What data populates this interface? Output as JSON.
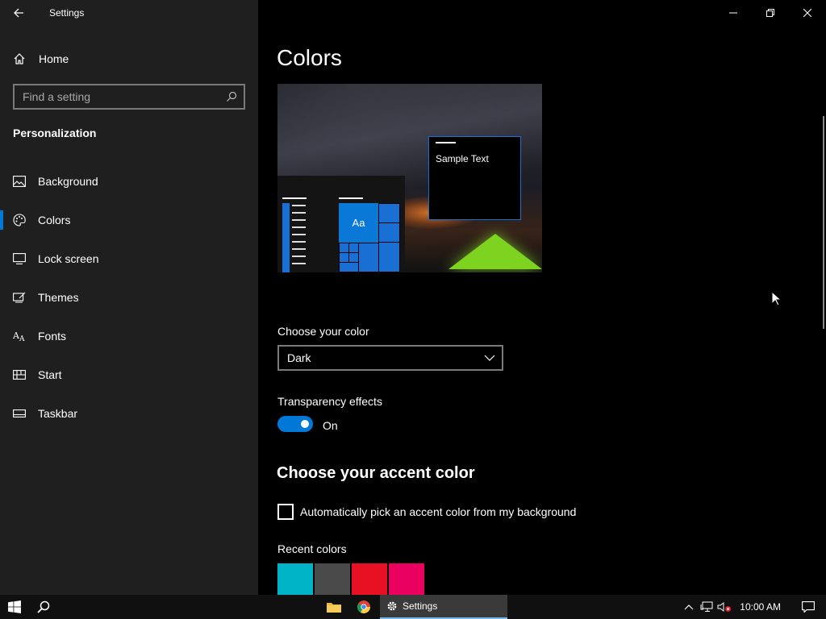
{
  "window": {
    "title": "Settings",
    "controls": {
      "minimize": "minimize",
      "maximize": "restore",
      "close": "close"
    }
  },
  "sidebar": {
    "home_label": "Home",
    "search": {
      "placeholder": "Find a setting"
    },
    "section_title": "Personalization",
    "items": [
      {
        "label": "Background",
        "icon": "picture-icon",
        "active": false
      },
      {
        "label": "Colors",
        "icon": "palette-icon",
        "active": true
      },
      {
        "label": "Lock screen",
        "icon": "lock-screen-icon",
        "active": false
      },
      {
        "label": "Themes",
        "icon": "themes-icon",
        "active": false
      },
      {
        "label": "Fonts",
        "icon": "fonts-icon",
        "active": false
      },
      {
        "label": "Start",
        "icon": "start-icon",
        "active": false
      },
      {
        "label": "Taskbar",
        "icon": "taskbar-icon",
        "active": false
      }
    ]
  },
  "main": {
    "title": "Colors",
    "preview": {
      "sample_text": "Sample Text",
      "tile_text": "Aa"
    },
    "choose_color": {
      "label": "Choose your color",
      "selected": "Dark"
    },
    "transparency": {
      "label": "Transparency effects",
      "state": "On",
      "enabled": true
    },
    "accent_heading": "Choose your accent color",
    "auto_pick_label": "Automatically pick an accent color from my background",
    "recent_colors_label": "Recent colors",
    "recent_colors": [
      "#00b4c8",
      "#4a4a4a",
      "#e81123",
      "#ea005e"
    ]
  },
  "taskbar": {
    "active_app_label": "Settings",
    "clock": "10:00 AM"
  },
  "colors": {
    "accent": "#0078d7",
    "sidebar_bg": "#1f1f1f",
    "main_bg": "#000000"
  }
}
